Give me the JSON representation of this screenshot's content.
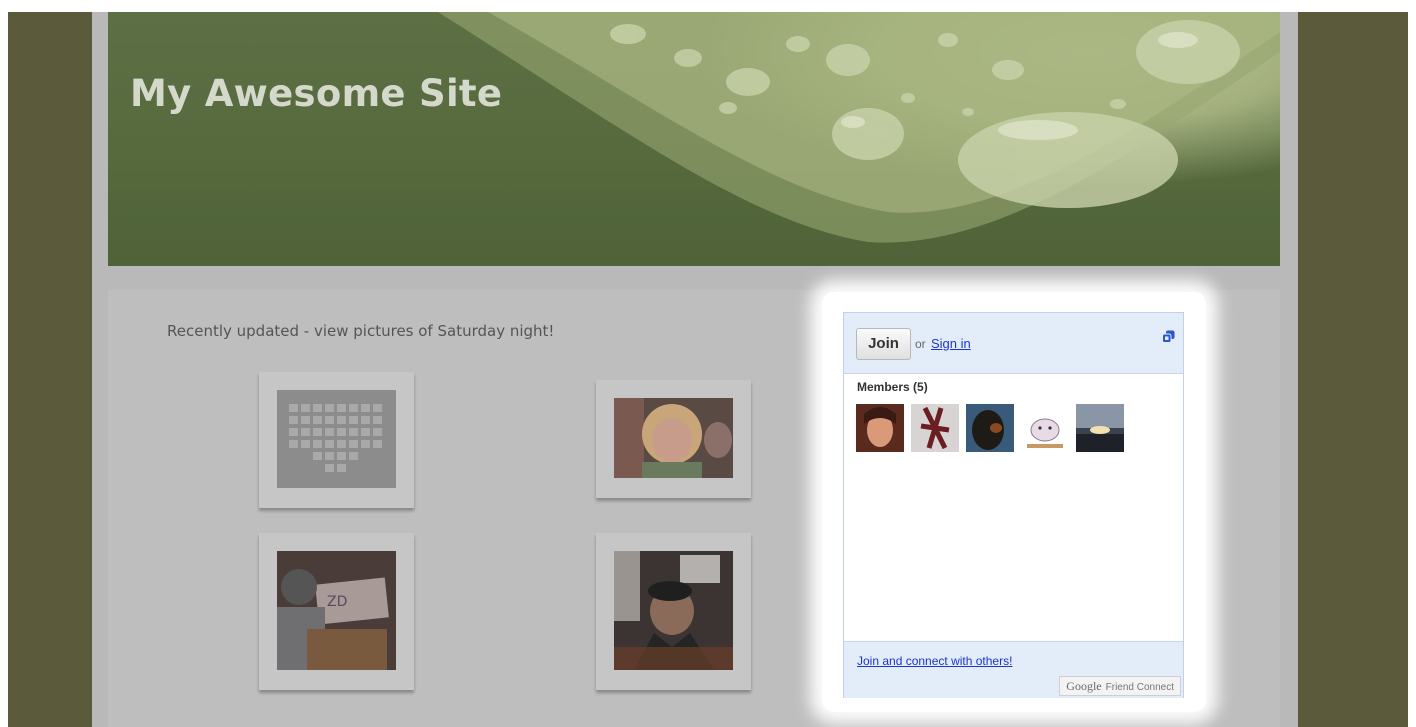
{
  "site": {
    "title": "My Awesome Site"
  },
  "content": {
    "headline": "Recently updated - view pictures of Saturday night!"
  },
  "photos": [
    {
      "name": "photo-collage"
    },
    {
      "name": "photo-smiling-woman"
    },
    {
      "name": "photo-person-drawing"
    },
    {
      "name": "photo-person-in-cap"
    }
  ],
  "friend_connect": {
    "join_label": "Join",
    "or_text": "or",
    "signin_label": "Sign in",
    "members_label": "Members (5)",
    "members": [
      {
        "icon": "member-avatar-1"
      },
      {
        "icon": "member-avatar-2"
      },
      {
        "icon": "member-avatar-3"
      },
      {
        "icon": "member-avatar-4"
      },
      {
        "icon": "member-avatar-5"
      }
    ],
    "join_connect_link": "Join and connect with others!",
    "brand_google": "Google",
    "brand_label": "Friend Connect"
  }
}
